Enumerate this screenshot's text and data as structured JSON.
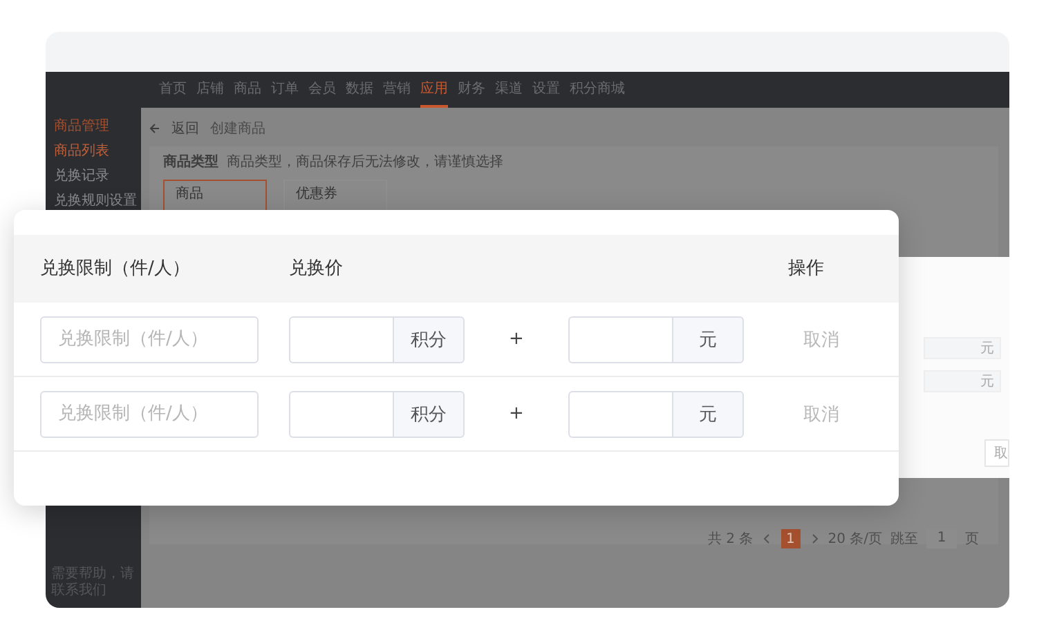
{
  "backdrop": {
    "nav": [
      {
        "label": "首页",
        "selected": false
      },
      {
        "label": "店铺",
        "selected": false
      },
      {
        "label": "商品",
        "selected": false
      },
      {
        "label": "订单",
        "selected": false
      },
      {
        "label": "会员",
        "selected": false
      },
      {
        "label": "数据",
        "selected": false
      },
      {
        "label": "营销",
        "selected": false
      },
      {
        "label": "应用",
        "selected": true
      },
      {
        "label": "财务",
        "selected": false
      },
      {
        "label": "渠道",
        "selected": false
      },
      {
        "label": "设置",
        "selected": false
      },
      {
        "label": "积分商城",
        "selected": false
      }
    ],
    "sidebar": {
      "group": "商品管理",
      "items": [
        {
          "label": "商品列表",
          "selected": true
        },
        {
          "label": "兑换记录",
          "selected": false
        },
        {
          "label": "兑换规则设置",
          "selected": false
        }
      ],
      "help": "需要帮助，请联系我们"
    },
    "breadcrumb": {
      "back": "返回",
      "title": "创建商品"
    },
    "product_type": {
      "label": "商品类型",
      "hint": "商品类型，商品保存后无法修改，请谨慎选择"
    },
    "type_cards": [
      {
        "label": "商品",
        "selected": true
      },
      {
        "label": "优惠券",
        "selected": false
      }
    ],
    "pagination": {
      "total": "共 2 条",
      "pages": [
        {
          "label": "1",
          "selected": true
        }
      ],
      "page_size": "20 条/页",
      "jump_label": "跳至",
      "jump_value": "1",
      "page_unit": "页"
    },
    "side_panel": {
      "rows": [
        {
          "unit": "元"
        },
        {
          "unit": "元"
        }
      ],
      "button": "取"
    }
  },
  "exchange_table": {
    "columns": [
      "兑换限制（件/人）",
      "兑换价",
      "操作"
    ],
    "rows": [
      {
        "limit_placeholder": "兑换限制（件/人）",
        "points_unit": "积分",
        "plus": "+",
        "cash_unit": "元",
        "action": "取消"
      },
      {
        "limit_placeholder": "兑换限制（件/人）",
        "points_unit": "积分",
        "plus": "+",
        "cash_unit": "元",
        "action": "取消"
      }
    ]
  }
}
